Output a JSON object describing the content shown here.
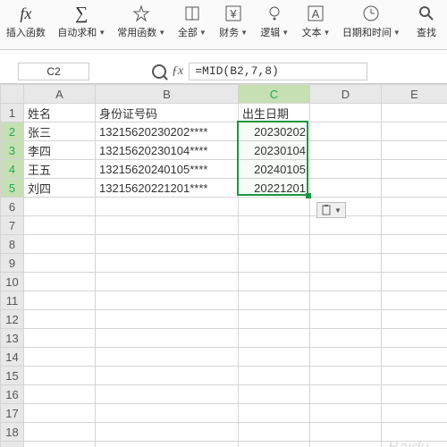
{
  "ribbon": [
    {
      "icon": "fx",
      "label": "插入函数",
      "dd": false
    },
    {
      "icon": "sigma",
      "label": "自动求和",
      "dd": true
    },
    {
      "icon": "star",
      "label": "常用函数",
      "dd": true
    },
    {
      "icon": "book",
      "label": "全部",
      "dd": true
    },
    {
      "icon": "yen",
      "label": "财务",
      "dd": true
    },
    {
      "icon": "q",
      "label": "逻辑",
      "dd": true
    },
    {
      "icon": "A",
      "label": "文本",
      "dd": true
    },
    {
      "icon": "clock",
      "label": "日期和时间",
      "dd": true
    },
    {
      "icon": "search",
      "label": "查找"
    }
  ],
  "namebox": "C2",
  "formula": "=MID(B2,7,8)",
  "columns": [
    "A",
    "B",
    "C",
    "D",
    "E"
  ],
  "selectedCol": "C",
  "selectedRows": [
    2,
    3,
    4,
    5
  ],
  "rowCount": 20,
  "data": {
    "1": {
      "A": "姓名",
      "B": "身份证号码",
      "C": "出生日期"
    },
    "2": {
      "A": "张三",
      "B": "13215620230202****",
      "C": "20230202"
    },
    "3": {
      "A": "李四",
      "B": "13215620230104****",
      "C": "20230104"
    },
    "4": {
      "A": "王五",
      "B": "13215620240105****",
      "C": "20240105"
    },
    "5": {
      "A": "刘四",
      "B": "13215620221201****",
      "C": "20221201"
    }
  },
  "rightAlign": {
    "C": [
      2,
      3,
      4,
      5
    ]
  },
  "pasteTag": "",
  "watermark": "Baidu"
}
